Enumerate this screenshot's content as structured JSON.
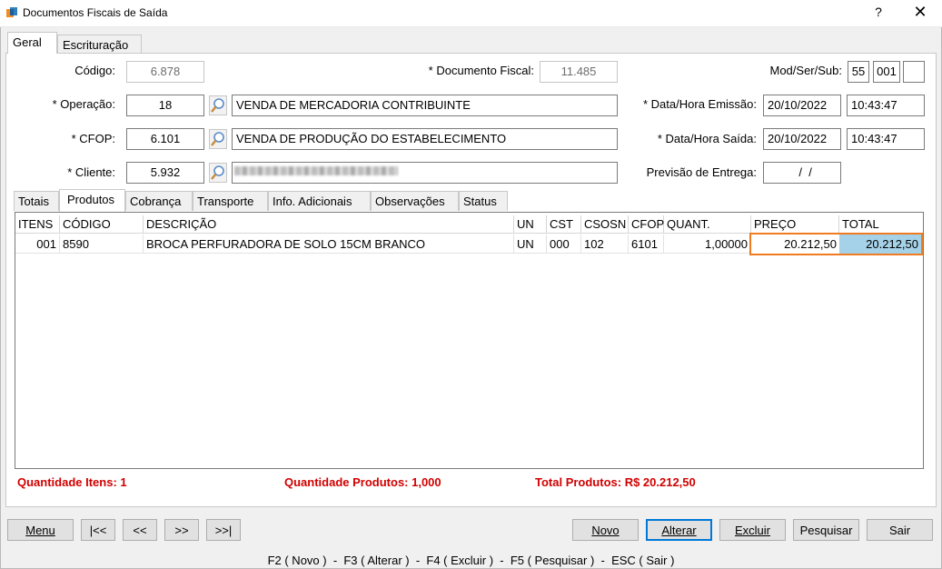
{
  "window": {
    "title": "Documentos Fiscais de Saída",
    "help_label": "?",
    "close_label": "✕"
  },
  "main_tabs": [
    {
      "label": "Geral"
    },
    {
      "label": "Escrituração"
    }
  ],
  "form": {
    "codigo": {
      "label": "Código:",
      "value": "6.878"
    },
    "documento_fiscal": {
      "label": "* Documento Fiscal:",
      "value": "11.485"
    },
    "mod_ser_sub": {
      "label": "Mod/Ser/Sub:",
      "mod": "55",
      "ser": "001",
      "sub": ""
    },
    "operacao": {
      "label": "* Operação:",
      "code": "18",
      "description": "VENDA DE MERCADORIA CONTRIBUINTE"
    },
    "data_hora_emissao": {
      "label": "* Data/Hora Emissão:",
      "date": "20/10/2022",
      "time": "10:43:47"
    },
    "cfop": {
      "label": "* CFOP:",
      "code": "6.101",
      "description": "VENDA DE PRODUÇÃO DO ESTABELECIMENTO"
    },
    "data_hora_saida": {
      "label": "* Data/Hora Saída:",
      "date": "20/10/2022",
      "time": "10:43:47"
    },
    "cliente": {
      "label": "* Cliente:",
      "code": "5.932"
    },
    "previsao_entrega": {
      "label": "Previsão de Entrega:",
      "value": "  /  /"
    }
  },
  "sub_tabs": [
    {
      "label": "Totais"
    },
    {
      "label": "Produtos"
    },
    {
      "label": "Cobrança"
    },
    {
      "label": "Transporte"
    },
    {
      "label": "Info. Adicionais"
    },
    {
      "label": "Observações"
    },
    {
      "label": "Status"
    }
  ],
  "grid": {
    "columns": [
      "ITENS",
      "CÓDIGO",
      "DESCRIÇÃO",
      "UN",
      "CST",
      "CSOSN",
      "CFOP",
      "QUANT.",
      "PREÇO",
      "TOTAL"
    ],
    "rows": [
      [
        "001",
        "8590",
        "BROCA PERFURADORA DE SOLO 15CM BRANCO",
        "UN",
        "000",
        "102",
        "6101",
        "1,00000",
        "20.212,50",
        "20.212,50"
      ]
    ]
  },
  "summary": {
    "qtd_itens": "Quantidade Itens: 1",
    "qtd_produtos": "Quantidade Produtos: 1,000",
    "total_produtos": "Total Produtos: R$ 20.212,50"
  },
  "nav_buttons": {
    "menu": "Menu",
    "first": "|<<",
    "prev": "<<",
    "next": ">>",
    "last": ">>|"
  },
  "action_buttons": {
    "novo": "Novo",
    "alterar": "Alterar",
    "excluir": "Excluir",
    "pesquisar": "Pesquisar",
    "sair": "Sair"
  },
  "shortcuts": "F2 ( Novo )  -  F3 ( Alterar )  -  F4 ( Excluir )  -  F5 ( Pesquisar )  -  ESC ( Sair )",
  "colors": {
    "accent_focus": "#0078d7",
    "highlight_border": "#f07b20",
    "selected_cell": "#a5d2e8",
    "summary_text": "#d10000"
  }
}
